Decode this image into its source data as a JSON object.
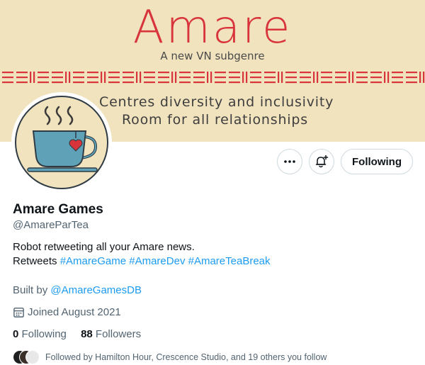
{
  "banner": {
    "title": "Amare",
    "subtitle": "A new VN subgenre",
    "line1": "Centres diversity and inclusivity",
    "line2": "Room for all relationships"
  },
  "actions": {
    "more_icon": "more-horizontal-icon",
    "notify_icon": "bell-plus-icon",
    "following_label": "Following"
  },
  "profile": {
    "name": "Amare Games",
    "handle": "@AmareParTea",
    "bio_line1": "Robot retweeting all your Amare news.",
    "bio_prefix": "Retweets",
    "hashtags": [
      "#AmareGame",
      "#AmareDev",
      "#AmareTeaBreak"
    ],
    "built_by_label": "Built by",
    "built_by_handle": "@AmareGamesDB",
    "joined": "Joined August 2021",
    "following_count": "0",
    "following_label": "Following",
    "followers_count": "88",
    "followers_label": "Followers",
    "followed_by": "Followed by Hamilton Hour, Crescence Studio, and 19 others you follow"
  },
  "colors": {
    "accent": "#1d9bf0",
    "banner_bg": "#f2e3bf",
    "banner_red": "#d8343c",
    "cup": "#5fa2b8"
  }
}
